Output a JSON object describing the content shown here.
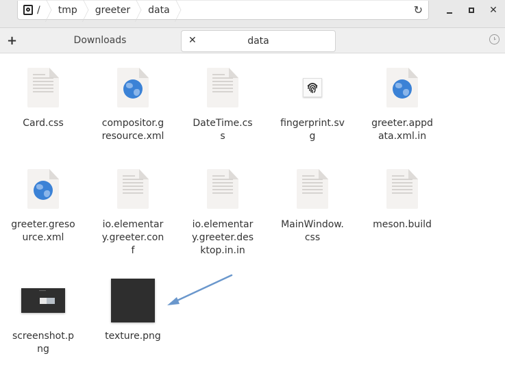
{
  "pathbar": {
    "root_label": "/",
    "crumbs": [
      "tmp",
      "greeter",
      "data"
    ],
    "reload_icon": "reload-icon"
  },
  "window_controls": {
    "minimize": "minimize-icon",
    "maximize": "maximize-icon",
    "close": "close-icon"
  },
  "tabs": {
    "new_tab_label": "+",
    "items": [
      {
        "label": "Downloads",
        "active": false
      },
      {
        "label": "data",
        "active": true,
        "close_label": "✕"
      }
    ],
    "history_icon": "history-clock-icon"
  },
  "files": [
    {
      "name": "Card.css",
      "icon": "text-document"
    },
    {
      "name": "compositor.gresource.xml",
      "icon": "xml-globe-document"
    },
    {
      "name": "DateTime.css",
      "icon": "text-document"
    },
    {
      "name": "fingerprint.svg",
      "icon": "fingerprint-thumbnail"
    },
    {
      "name": "greeter.appdata.xml.in",
      "icon": "xml-globe-document"
    },
    {
      "name": "greeter.gresource.xml",
      "icon": "xml-globe-document"
    },
    {
      "name": "io.elementary.greeter.conf",
      "icon": "text-document"
    },
    {
      "name": "io.elementary.greeter.desktop.in.in",
      "icon": "text-document"
    },
    {
      "name": "MainWindow.css",
      "icon": "text-document"
    },
    {
      "name": "meson.build",
      "icon": "text-document"
    },
    {
      "name": "screenshot.png",
      "icon": "image-thumbnail"
    },
    {
      "name": "texture.png",
      "icon": "image-thumbnail"
    }
  ],
  "annotation": {
    "arrow_color": "#6a97cc",
    "points_to": "texture.png"
  }
}
